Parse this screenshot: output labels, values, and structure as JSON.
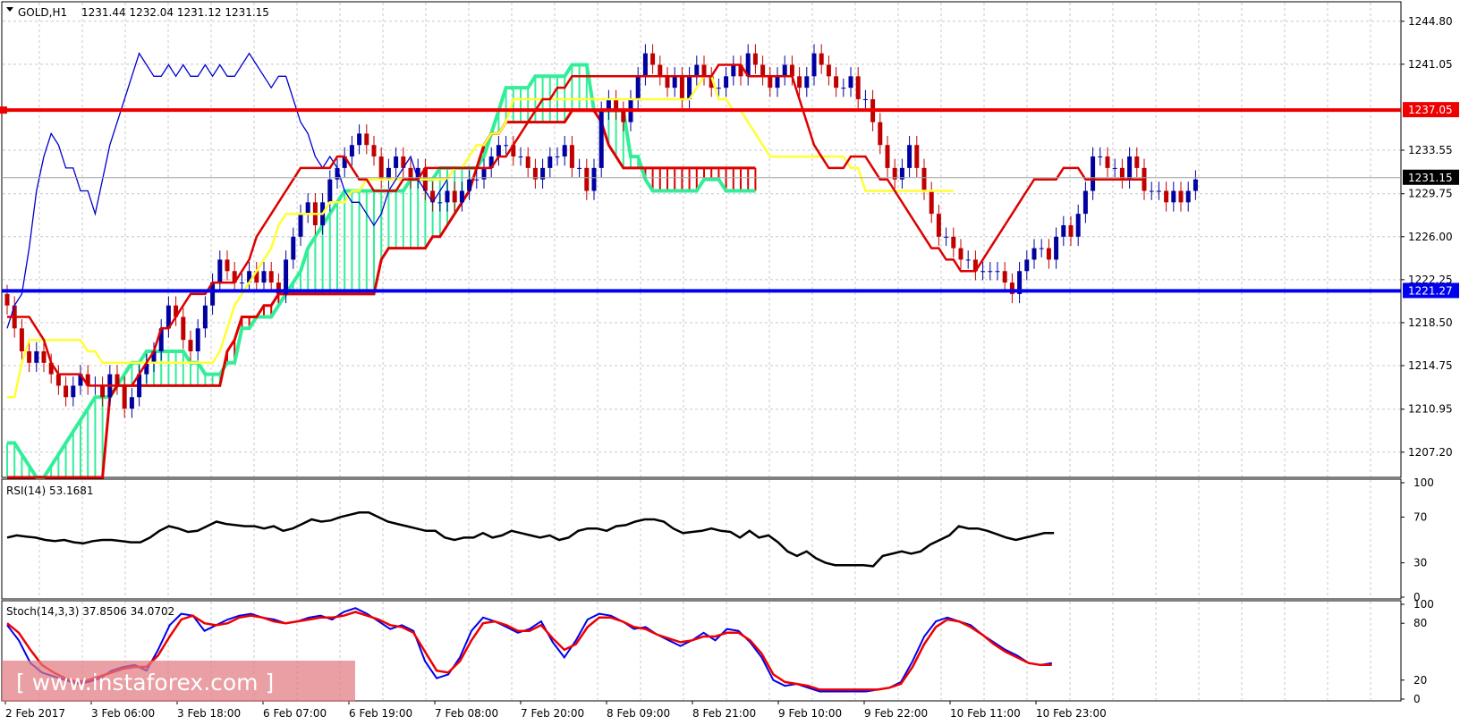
{
  "title": "GOLD,H1",
  "ohlc": "1231.44 1232.04 1231.12 1231.15",
  "watermark": "[ www.instaforex.com ]",
  "colors": {
    "background": "#ffffff",
    "grid": "#c8c8c8",
    "bull": "#0000a0",
    "bear": "#c00000",
    "tenkan": "#dd0000",
    "kijun": "#ffff33",
    "chikou": "#0000cc",
    "cloud_bull": "#33ee99",
    "cloud_bear": "#dd0000",
    "resistance": "#ee0000",
    "support": "#0000ee",
    "rsi": "#000000",
    "stoch_main": "#0000ee",
    "stoch_signal": "#ee0000"
  },
  "chart_data": [
    {
      "type": "candlestick",
      "name": "price",
      "title": "GOLD,H1",
      "ohlc_label": "1231.44 1232.04 1231.12 1231.15",
      "ylim": [
        1205.0,
        1246.5
      ],
      "y_ticks": [
        "1244.80",
        "1241.05",
        "1233.55",
        "1229.75",
        "1226.00",
        "1222.25",
        "1218.50",
        "1214.75",
        "1210.95",
        "1207.20"
      ],
      "x_ticks": [
        "2 Feb 2017",
        "3 Feb 06:00",
        "3 Feb 18:00",
        "6 Feb 07:00",
        "6 Feb 19:00",
        "7 Feb 08:00",
        "7 Feb 20:00",
        "8 Feb 09:00",
        "8 Feb 21:00",
        "9 Feb 10:00",
        "9 Feb 22:00",
        "10 Feb 11:00",
        "10 Feb 23:00"
      ],
      "resistance_level": 1237.05,
      "resistance_label": "1237.05",
      "support_level": 1221.27,
      "support_label": "1221.27",
      "last_price": 1231.15,
      "last_price_label": "1231.15",
      "candle_closes": [
        1220,
        1218,
        1216,
        1215,
        1216,
        1215,
        1214,
        1213,
        1212,
        1213,
        1214,
        1213,
        1213,
        1212,
        1214,
        1213,
        1211,
        1212,
        1214,
        1215,
        1216,
        1218,
        1220,
        1219,
        1217,
        1216,
        1218,
        1220,
        1222,
        1224,
        1223,
        1222,
        1222,
        1223,
        1222,
        1223,
        1222,
        1221,
        1224,
        1226,
        1228,
        1229,
        1227,
        1229,
        1231,
        1232,
        1233,
        1234,
        1235,
        1234,
        1233,
        1231,
        1232,
        1233,
        1232,
        1231,
        1232,
        1230,
        1229,
        1229,
        1230,
        1229,
        1230,
        1231,
        1231,
        1232,
        1233,
        1234,
        1234,
        1233,
        1233,
        1232,
        1231,
        1232,
        1233,
        1233,
        1234,
        1232,
        1232,
        1230,
        1232,
        1237,
        1238,
        1237,
        1236,
        1238,
        1240,
        1242,
        1241,
        1240,
        1239,
        1240,
        1238,
        1240,
        1241,
        1240,
        1239,
        1239,
        1240,
        1241,
        1240,
        1242,
        1241,
        1240,
        1239,
        1240,
        1241,
        1240,
        1239,
        1240,
        1242,
        1241,
        1240,
        1239,
        1239,
        1240,
        1238,
        1238,
        1236,
        1234,
        1232,
        1231,
        1232,
        1234,
        1232,
        1230,
        1228,
        1226,
        1226,
        1225,
        1224,
        1224,
        1223,
        1223,
        1223,
        1223,
        1222,
        1221,
        1223,
        1224,
        1225,
        1225,
        1224,
        1226,
        1227,
        1226,
        1228,
        1230,
        1233,
        1233,
        1232,
        1232,
        1231,
        1233,
        1232,
        1230,
        1230,
        1230,
        1229,
        1230,
        1229,
        1230,
        1231
      ],
      "tenkan": [
        1219,
        1219,
        1219,
        1219,
        1218,
        1217,
        1215,
        1214,
        1214,
        1214,
        1214,
        1213,
        1213,
        1213,
        1213,
        1213,
        1213,
        1213,
        1214,
        1215,
        1216,
        1218,
        1218,
        1219,
        1220,
        1221,
        1221,
        1221,
        1222,
        1222,
        1222,
        1222,
        1223,
        1224,
        1226,
        1227,
        1228,
        1229,
        1230,
        1231,
        1232,
        1232,
        1232,
        1232,
        1232,
        1233,
        1233,
        1232,
        1231,
        1231,
        1230,
        1230,
        1230,
        1230,
        1231,
        1231,
        1231,
        1232,
        1232,
        1232,
        1232,
        1232,
        1232,
        1232,
        1232,
        1232,
        1232,
        1233,
        1233,
        1234,
        1235,
        1236,
        1237,
        1238,
        1238,
        1239,
        1239,
        1240,
        1240,
        1240,
        1240,
        1240,
        1240,
        1240,
        1240,
        1240,
        1240,
        1240,
        1240,
        1240,
        1240,
        1240,
        1240,
        1240,
        1240,
        1240,
        1240,
        1241,
        1241,
        1241,
        1241,
        1240,
        1240,
        1240,
        1240,
        1240,
        1240,
        1240,
        1238,
        1236,
        1234,
        1233,
        1232,
        1232,
        1232,
        1233,
        1233,
        1233,
        1232,
        1231,
        1231,
        1230,
        1229,
        1228,
        1227,
        1226,
        1225,
        1225,
        1224,
        1224,
        1223,
        1223,
        1223,
        1224,
        1225,
        1226,
        1227,
        1228,
        1229,
        1230,
        1231,
        1231,
        1231,
        1231,
        1232,
        1232,
        1232,
        1231,
        1231,
        1231,
        1231,
        1231,
        1231,
        1231,
        1231,
        1231
      ],
      "kijun": [
        1212,
        1212,
        1215,
        1217,
        1217,
        1217,
        1217,
        1217,
        1217,
        1217,
        1217,
        1216,
        1216,
        1215,
        1215,
        1215,
        1215,
        1215,
        1215,
        1215,
        1215,
        1215,
        1215,
        1215,
        1215,
        1215,
        1215,
        1215,
        1215,
        1216,
        1218,
        1220,
        1221,
        1222,
        1223,
        1224,
        1225,
        1227,
        1228,
        1228,
        1228,
        1228,
        1228,
        1228,
        1229,
        1229,
        1229,
        1230,
        1230,
        1231,
        1231,
        1231,
        1231,
        1231,
        1231,
        1231,
        1231,
        1231,
        1231,
        1231,
        1231,
        1232,
        1232,
        1233,
        1234,
        1234,
        1235,
        1235,
        1236,
        1238,
        1238,
        1238,
        1238,
        1238,
        1238,
        1238,
        1238,
        1238,
        1238,
        1238,
        1238,
        1238,
        1238,
        1238,
        1238,
        1238,
        1238,
        1238,
        1238,
        1238,
        1238,
        1238,
        1238,
        1238,
        1239,
        1240,
        1240,
        1238,
        1238,
        1237,
        1237,
        1236,
        1235,
        1234,
        1233,
        1233,
        1233,
        1233,
        1233,
        1233,
        1233,
        1233,
        1233,
        1233,
        1233,
        1232,
        1232,
        1230,
        1230,
        1230,
        1230,
        1230,
        1230,
        1230,
        1230,
        1230,
        1230,
        1230,
        1230,
        1230
      ],
      "kijun_start_bar": 0,
      "chikou_start_bar": 0,
      "chikou": [
        1218,
        1220,
        1221,
        1225,
        1230,
        1233,
        1235,
        1234,
        1232,
        1232,
        1230,
        1230,
        1228,
        1231,
        1234,
        1236,
        1238,
        1240,
        1242,
        1241,
        1240,
        1240,
        1241,
        1240,
        1241,
        1240,
        1240,
        1241,
        1240,
        1241,
        1240,
        1240,
        1241,
        1242,
        1241,
        1240,
        1239,
        1240,
        1240,
        1238,
        1236,
        1235,
        1233,
        1232,
        1233,
        1232,
        1230,
        1229,
        1229,
        1228,
        1227,
        1228,
        1230,
        1231,
        1232,
        1233,
        1231,
        1230,
        1229,
        1230,
        1231
      ],
      "span_a": [
        1208,
        1208,
        1207,
        1206,
        1205,
        1205,
        1206,
        1207,
        1208,
        1209,
        1210,
        1211,
        1212,
        1212,
        1212,
        1213,
        1214,
        1215,
        1215,
        1216,
        1216,
        1216,
        1216,
        1216,
        1216,
        1215,
        1215,
        1214,
        1214,
        1214,
        1215,
        1215,
        1218,
        1218,
        1219,
        1219,
        1219,
        1220,
        1221,
        1222,
        1223,
        1225,
        1226,
        1227,
        1228,
        1229,
        1230,
        1230,
        1230,
        1230,
        1230,
        1230,
        1230,
        1230,
        1230,
        1231,
        1231,
        1231,
        1231,
        1232,
        1232,
        1232,
        1232,
        1232,
        1232,
        1233,
        1235,
        1237,
        1239,
        1239,
        1239,
        1239,
        1240,
        1240,
        1240,
        1240,
        1240,
        1241,
        1241,
        1241,
        1237,
        1237,
        1237,
        1237,
        1237,
        1233,
        1233,
        1231,
        1230,
        1230,
        1230,
        1230,
        1230,
        1230,
        1230,
        1231,
        1231,
        1231,
        1230,
        1230,
        1230,
        1230,
        1230
      ],
      "span_b": [
        1205,
        1205,
        1205,
        1205,
        1205,
        1205,
        1205,
        1205,
        1205,
        1205,
        1205,
        1205,
        1205,
        1205,
        1212,
        1213,
        1213,
        1213,
        1213,
        1213,
        1213,
        1213,
        1213,
        1213,
        1213,
        1213,
        1213,
        1213,
        1213,
        1213,
        1216,
        1217,
        1219,
        1219,
        1219,
        1220,
        1220,
        1221,
        1221,
        1221,
        1221,
        1221,
        1221,
        1221,
        1221,
        1221,
        1221,
        1221,
        1221,
        1221,
        1221,
        1224,
        1225,
        1225,
        1225,
        1225,
        1225,
        1225,
        1226,
        1226,
        1227,
        1228,
        1229,
        1230,
        1232,
        1234,
        1235,
        1235,
        1236,
        1236,
        1236,
        1236,
        1236,
        1236,
        1236,
        1236,
        1236,
        1237,
        1237,
        1237,
        1237,
        1236,
        1234,
        1233,
        1232,
        1232,
        1232,
        1232,
        1232,
        1232,
        1232,
        1232,
        1232,
        1232,
        1232,
        1232,
        1232,
        1232,
        1232,
        1232,
        1232,
        1232,
        1232
      ]
    },
    {
      "type": "line",
      "name": "rsi",
      "label": "RSI(14) 53.1681",
      "ylim": [
        0,
        100
      ],
      "y_ticks": [
        "100",
        "70",
        "30",
        "0"
      ],
      "values": [
        52,
        54,
        53,
        52,
        50,
        49,
        50,
        48,
        47,
        49,
        50,
        50,
        49,
        48,
        48,
        52,
        58,
        62,
        60,
        57,
        58,
        62,
        66,
        64,
        63,
        62,
        62,
        60,
        62,
        58,
        60,
        64,
        68,
        66,
        67,
        70,
        72,
        74,
        74,
        70,
        66,
        64,
        62,
        60,
        58,
        58,
        52,
        50,
        52,
        52,
        56,
        52,
        54,
        58,
        56,
        54,
        52,
        54,
        50,
        52,
        58,
        60,
        60,
        58,
        62,
        63,
        66,
        68,
        68,
        66,
        60,
        56,
        57,
        58,
        60,
        58,
        57,
        52,
        58,
        52,
        54,
        48,
        40,
        36,
        40,
        34,
        30,
        28,
        28,
        28,
        28,
        27,
        36,
        38,
        40,
        38,
        40,
        46,
        50,
        54,
        62,
        60,
        60,
        58,
        55,
        52,
        50,
        52,
        54,
        56,
        56
      ]
    },
    {
      "type": "line",
      "name": "stochastic",
      "label": "Stoch(14,3,3) 37.8506 34.0702",
      "ylim": [
        0,
        100
      ],
      "y_ticks": [
        "100",
        "80",
        "20",
        "0"
      ],
      "series": [
        {
          "name": "main",
          "values": [
            78,
            62,
            38,
            28,
            24,
            20,
            16,
            18,
            22,
            30,
            34,
            36,
            30,
            52,
            78,
            90,
            88,
            72,
            78,
            84,
            88,
            90,
            86,
            84,
            80,
            82,
            86,
            88,
            84,
            92,
            96,
            90,
            82,
            74,
            78,
            72,
            40,
            22,
            26,
            44,
            72,
            86,
            82,
            76,
            70,
            74,
            82,
            60,
            44,
            62,
            84,
            90,
            88,
            82,
            74,
            76,
            68,
            62,
            56,
            62,
            70,
            62,
            74,
            72,
            60,
            44,
            20,
            14,
            16,
            12,
            8,
            8,
            8,
            8,
            8,
            10,
            12,
            18,
            40,
            66,
            82,
            86,
            82,
            78,
            68,
            60,
            52,
            46,
            38,
            36,
            38
          ]
        },
        {
          "name": "signal",
          "values": [
            80,
            70,
            52,
            36,
            28,
            22,
            18,
            20,
            24,
            28,
            32,
            34,
            34,
            46,
            66,
            84,
            88,
            80,
            78,
            80,
            86,
            88,
            86,
            82,
            80,
            82,
            84,
            86,
            86,
            88,
            92,
            88,
            84,
            78,
            76,
            70,
            50,
            30,
            28,
            40,
            62,
            80,
            82,
            78,
            72,
            72,
            78,
            64,
            52,
            58,
            76,
            86,
            86,
            82,
            76,
            74,
            68,
            64,
            60,
            62,
            66,
            66,
            70,
            70,
            62,
            48,
            26,
            18,
            16,
            14,
            10,
            10,
            10,
            10,
            10,
            10,
            12,
            16,
            34,
            58,
            76,
            84,
            82,
            76,
            68,
            58,
            50,
            44,
            38,
            36,
            36
          ]
        }
      ]
    }
  ]
}
